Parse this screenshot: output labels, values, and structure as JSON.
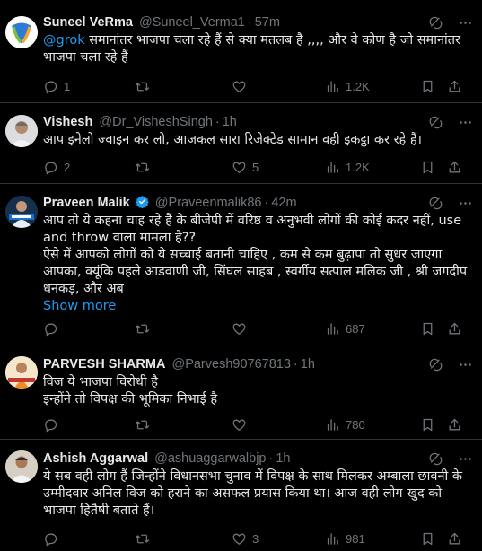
{
  "tweets": [
    {
      "name": "Suneel VeRma",
      "handle": "@Suneel_Verma1",
      "dot": "·",
      "time": "57m",
      "mention": "@grok",
      "text": " समानांतर भाजपा चला रहे हैं से क्या मतलब है ,,,, और वे कोण है जो समानांतर भाजपा चला रहे हैं",
      "replies": "1",
      "reposts": "",
      "likes": "",
      "views": "1.2K"
    },
    {
      "name": "Vishesh",
      "handle": "@Dr_VisheshSingh",
      "dot": "·",
      "time": "1h",
      "text": "आप इनेलो ज्वाइन कर लो, आजकल सारा रिजेक्टेड सामान वही इकट्ठा कर रहे हैं।",
      "replies": "2",
      "reposts": "",
      "likes": "5",
      "views": "1.2K"
    },
    {
      "name": "Praveen Malik",
      "handle": "@Praveenmalik86",
      "dot": "·",
      "time": "42m",
      "text1": "आप तो ये कहना चाह रहे हैं के बीजेपी में वरिष्ठ व अनुभवी लोगों की कोई कदर नहीं, use and throw वाला मामला है??",
      "text2": "ऐसे में आपको लोगों को ये सच्चाई बतानी चाहिए , कम से कम बुढ़ापा तो सुधर जाएगा आपका, क्यूंकि पहले आडवाणी जी, सिंघल साहब , स्वर्गीय सत्पाल मलिक जी , श्री जगदीप धनकड़, और अब",
      "show_more": "Show more",
      "replies": "",
      "reposts": "",
      "likes": "",
      "views": "687"
    },
    {
      "name": "PARVESH SHARMA",
      "handle": "@Parvesh90767813",
      "dot": "·",
      "time": "1h",
      "text1": "विज ये भाजपा विरोधी है",
      "text2": "इन्होंने तो विपक्ष की भूमिका निभाई है",
      "replies": "",
      "reposts": "",
      "likes": "",
      "views": "780"
    },
    {
      "name": "Ashish Aggarwal",
      "handle": "@ashuaggarwalbjp",
      "dot": "·",
      "time": "1h",
      "text": "ये सब वही लोग हैं जिन्होंने विधानसभा चुनाव में विपक्ष के साथ मिलकर अम्बाला छावनी के उम्मीदवार अनिल विज को हराने का असफल प्रयास किया था। आज वही लोग खुद को भाजपा हितैषी बताते हैं।",
      "replies": "",
      "reposts": "",
      "likes": "3",
      "views": "981"
    }
  ],
  "colors": {
    "background": "#000000",
    "text": "#e7e9ea",
    "muted": "#71767b",
    "accent": "#1d9bf0",
    "divider": "#2f3336"
  },
  "icons": [
    "grok-icon",
    "more-icon",
    "reply-icon",
    "repost-icon",
    "like-icon",
    "views-icon",
    "bookmark-icon",
    "share-icon",
    "verified-badge-icon"
  ]
}
